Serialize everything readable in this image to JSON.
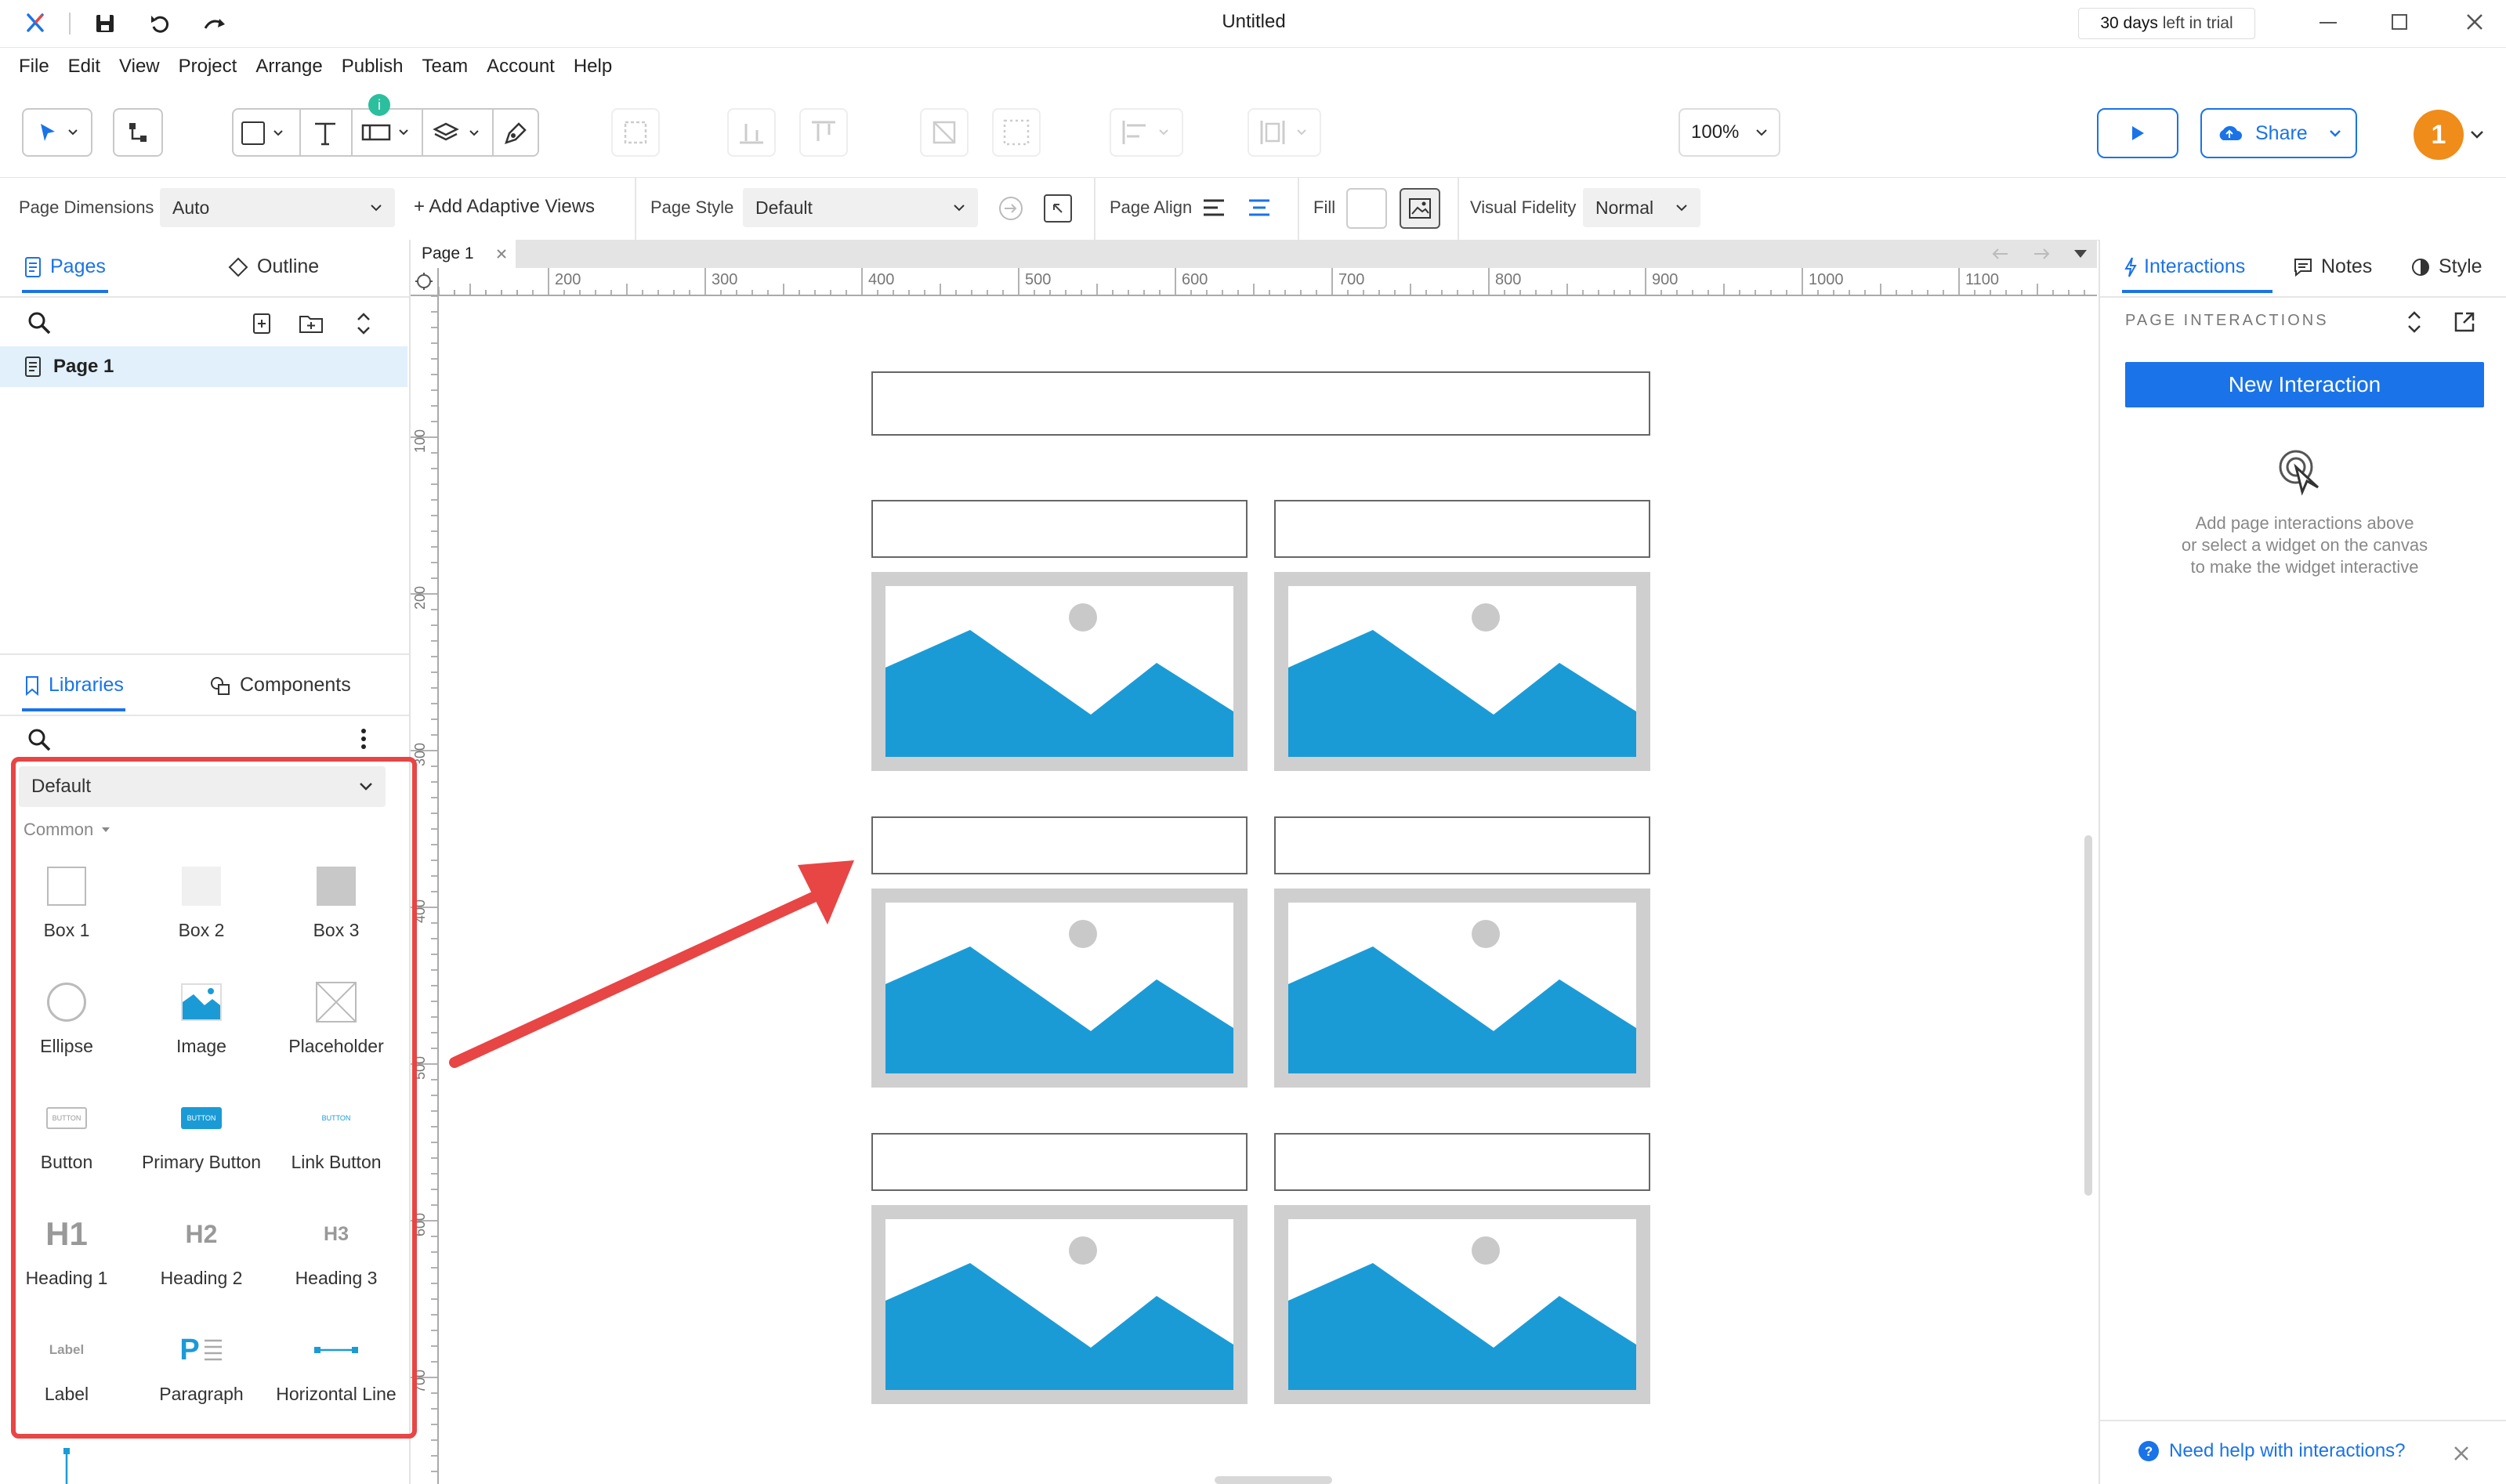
{
  "app": {
    "title": "Untitled",
    "trial_days": "30 days",
    "trial_suffix": "left in trial"
  },
  "menu": [
    "File",
    "Edit",
    "View",
    "Project",
    "Arrange",
    "Publish",
    "Team",
    "Account",
    "Help"
  ],
  "toolbar": {
    "zoom": "100%",
    "share_label": "Share",
    "avatar_initial": "1",
    "badge_text": "i"
  },
  "props": {
    "page_dimensions_label": "Page Dimensions",
    "page_dimensions_value": "Auto",
    "add_adaptive_label": "+ Add Adaptive Views",
    "page_style_label": "Page Style",
    "page_style_value": "Default",
    "page_align_label": "Page Align",
    "fill_label": "Fill",
    "visual_fidelity_label": "Visual Fidelity",
    "visual_fidelity_value": "Normal"
  },
  "left": {
    "tabs": {
      "pages": "Pages",
      "outline": "Outline"
    },
    "pages": [
      "Page 1"
    ],
    "lib_tabs": {
      "libraries": "Libraries",
      "components": "Components"
    },
    "library_select": "Default",
    "section": "Common",
    "items": [
      "Box 1",
      "Box 2",
      "Box 3",
      "Ellipse",
      "Image",
      "Placeholder",
      "Button",
      "Primary Button",
      "Link Button",
      "Heading 1",
      "Heading 2",
      "Heading 3",
      "Label",
      "Paragraph",
      "Horizontal Line"
    ],
    "icon_text": {
      "button": "BUTTON",
      "h1": "H1",
      "h2": "H2",
      "h3": "H3",
      "label": "Label",
      "para": "P"
    }
  },
  "canvas": {
    "tab_label": "Page 1",
    "ruler_h": [
      "200",
      "300",
      "400",
      "500",
      "600",
      "700",
      "800",
      "900",
      "1000",
      "1100"
    ],
    "ruler_v": [
      "100",
      "200",
      "300",
      "400",
      "500",
      "600",
      "700"
    ]
  },
  "right": {
    "tabs": {
      "interactions": "Interactions",
      "notes": "Notes",
      "style": "Style"
    },
    "section_title": "PAGE INTERACTIONS",
    "new_interaction": "New Interaction",
    "help_lines": [
      "Add page interactions above",
      "or select a widget on the canvas",
      "to make the widget interactive"
    ],
    "need_help": "Need help with interactions?"
  },
  "colors": {
    "accent": "#1a73e8",
    "image_blue": "#1b9bd6",
    "highlight_red": "#e84545",
    "avatar_orange": "#f08c1a"
  }
}
